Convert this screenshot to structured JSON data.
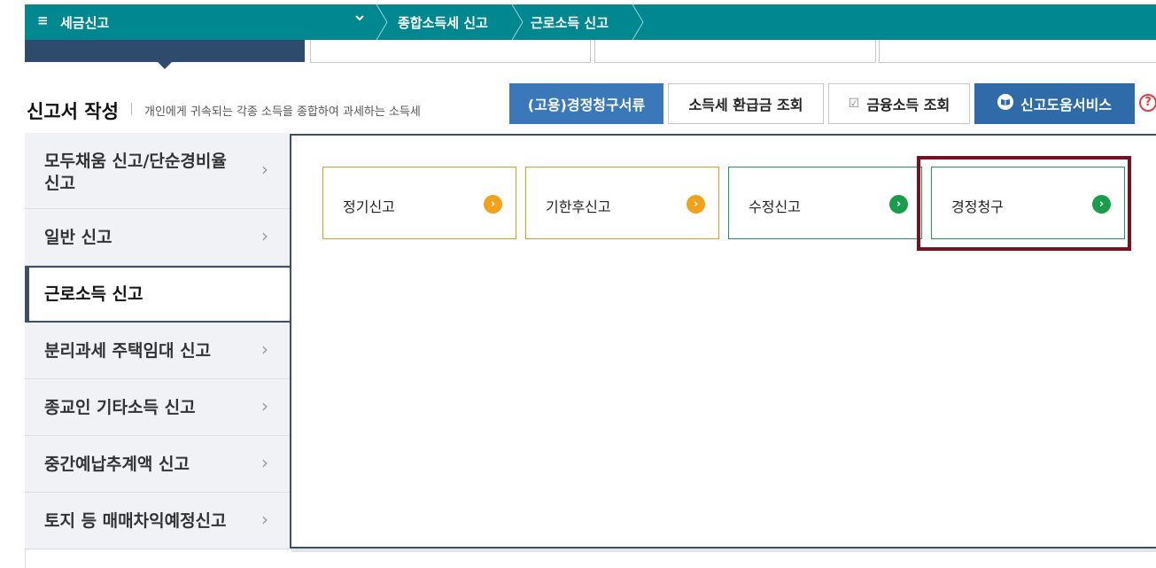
{
  "topbar": {
    "menu_icon": "≡",
    "title": "세금신고",
    "dropdown_icon": "chevron-down",
    "breadcrumbs": [
      "종합소득세 신고",
      "근로소득 신고"
    ]
  },
  "section": {
    "title": "신고서 작성",
    "description": "개인에게 귀속되는 각종 소득을 종합하여 과세하는 소득세"
  },
  "header_buttons": [
    {
      "label": "(고용)경정청구서류"
    },
    {
      "label": "소득세 환급금 조회"
    },
    {
      "label": "금융소득 조회",
      "icon": "☑"
    },
    {
      "label": "신고도움서비스",
      "icon": "📖"
    }
  ],
  "help_icon": "?",
  "side_menu": [
    {
      "label": "모두채움 신고/단순경비율 신고",
      "active": false
    },
    {
      "label": "일반 신고",
      "active": false
    },
    {
      "label": "근로소득 신고",
      "active": true
    },
    {
      "label": "분리과세 주택임대 신고",
      "active": false
    },
    {
      "label": "종교인 기타소득 신고",
      "active": false
    },
    {
      "label": "중간예납추계액 신고",
      "active": false
    },
    {
      "label": "토지 등 매매차익예정신고",
      "active": false
    }
  ],
  "arrow_glyph": "›",
  "go_glyph": "›",
  "cards": [
    {
      "label": "정기신고",
      "color": "yellow"
    },
    {
      "label": "기한후신고",
      "color": "yellow"
    },
    {
      "label": "수정신고",
      "color": "green"
    },
    {
      "label": "경정청구",
      "color": "green"
    }
  ],
  "colors": {
    "topbar": "#00878f",
    "active_tab": "#2e4a6d",
    "primary_button": "#3a78b9",
    "highlight": "#7b0f22",
    "yellow": "#f1a11a",
    "green": "#1a9d4a"
  }
}
